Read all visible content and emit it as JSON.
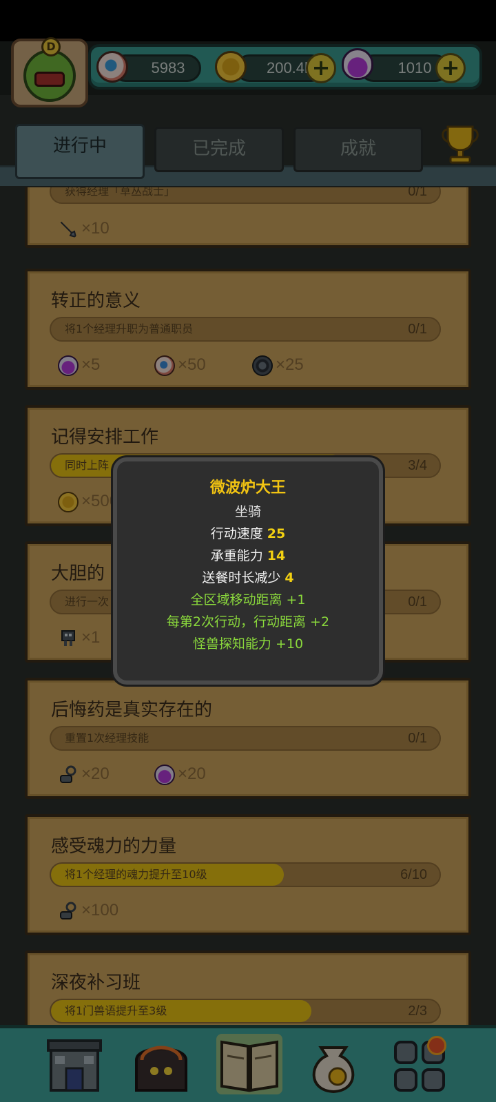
{
  "resources": {
    "eyes": "5983",
    "coins": "200.4k",
    "potions": "1010",
    "plus_label": "+"
  },
  "avatar": {
    "badge": "D"
  },
  "tabs": [
    {
      "label": "进行中",
      "active": true
    },
    {
      "label": "已完成",
      "active": false
    },
    {
      "label": "成就",
      "active": false
    }
  ],
  "quests": [
    {
      "title": "",
      "task": "获得经理「草丛战士」",
      "progress_text": "0/1",
      "progress": 0,
      "rewards": [
        {
          "icon": "dagger-icon",
          "qty": "×10"
        }
      ]
    },
    {
      "title": "转正的意义",
      "task": "将1个经理升职为普通职员",
      "progress_text": "0/1",
      "progress": 0,
      "rewards": [
        {
          "icon": "potion-icon",
          "qty": "×5"
        },
        {
          "icon": "eyeball-icon",
          "qty": "×50"
        },
        {
          "icon": "tire-icon",
          "qty": "×25"
        }
      ]
    },
    {
      "title": "记得安排工作",
      "task": "同时上阵",
      "progress_text": "3/4",
      "progress": 0.75,
      "rewards": [
        {
          "icon": "coin-icon",
          "qty": "×500"
        }
      ]
    },
    {
      "title": "大胆的",
      "task": "进行一次",
      "progress_text": "0/1",
      "progress": 0,
      "rewards": [
        {
          "icon": "robot-icon",
          "qty": "×1"
        }
      ]
    },
    {
      "title": "后悔药是真实存在的",
      "task": "重置1次经理技能",
      "progress_text": "0/1",
      "progress": 0,
      "rewards": [
        {
          "icon": "chain-icon",
          "qty": "×20"
        },
        {
          "icon": "potion-icon",
          "qty": "×20"
        }
      ]
    },
    {
      "title": "感受魂力的力量",
      "task": "将1个经理的魂力提升至10级",
      "progress_text": "6/10",
      "progress": 0.6,
      "rewards": [
        {
          "icon": "chain-icon",
          "qty": "×100"
        }
      ]
    },
    {
      "title": "深夜补习班",
      "task": "将1门兽语提升至3级",
      "progress_text": "2/3",
      "progress": 0.667,
      "rewards": []
    }
  ],
  "popup": {
    "title": "微波炉大王",
    "subtitle": "坐骑",
    "stats": [
      {
        "label": "行动速度",
        "value": "25"
      },
      {
        "label": "承重能力",
        "value": "14"
      },
      {
        "label": "送餐时长减少",
        "value": "4"
      }
    ],
    "bonuses": [
      "全区域移动距离 +1",
      "每第2次行动，行动距离 +2",
      "怪兽探知能力 +10"
    ]
  },
  "bottom_nav": [
    {
      "icon": "shop-building-icon"
    },
    {
      "icon": "monster-furnace-icon"
    },
    {
      "icon": "quest-book-icon",
      "active": true
    },
    {
      "icon": "money-bag-icon"
    },
    {
      "icon": "menu-grid-icon",
      "notification": true
    }
  ],
  "colors": {
    "accent_yellow": "#f2c412",
    "bonus_green": "#8ad83c",
    "card_bg": "#caa25c",
    "progress_fill": "#e6c014",
    "teal": "#3fa29a"
  }
}
